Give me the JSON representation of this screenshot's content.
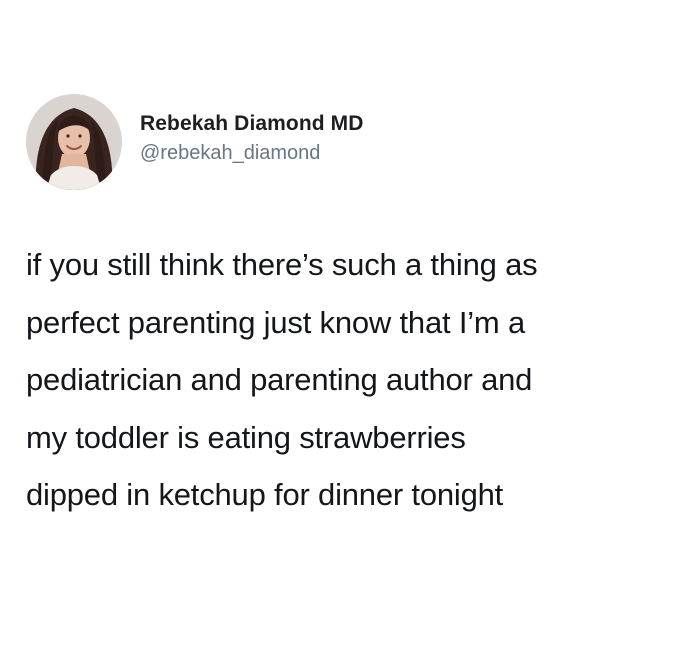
{
  "tweet": {
    "author": {
      "display_name": "Rebekah Diamond MD",
      "handle": "@rebekah_diamond",
      "avatar_icon": "profile-photo-avatar"
    },
    "text_lines": [
      "if you still think there’s such a thing as",
      "perfect parenting just know that I’m a",
      "pediatrician and parenting author and",
      "my toddler is eating strawberries",
      "dipped in ketchup for dinner tonight"
    ]
  },
  "colors": {
    "background": "#ffffff",
    "text": "#14171a",
    "handle": "#687684"
  }
}
